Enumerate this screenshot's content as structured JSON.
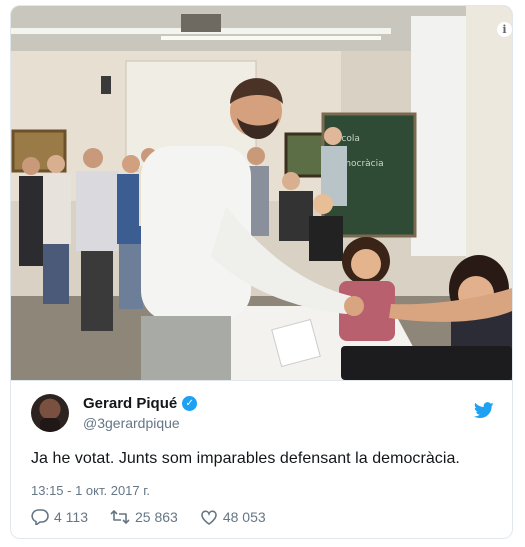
{
  "tweet": {
    "author_name": "Gerard Piqué",
    "handle": "@3gerardpique",
    "text": "Ja he votat. Junts som imparables defensant la democràcia.",
    "timestamp": "13:15 - 1 окт. 2017 г.",
    "replies": "4 113",
    "retweets": "25 863",
    "likes": "48 053"
  },
  "icons": {
    "info": "info-icon",
    "verified": "verified-badge-icon",
    "bird": "twitter-bird-icon",
    "reply": "reply-icon",
    "retweet": "retweet-icon",
    "like": "heart-icon"
  },
  "colors": {
    "accent": "#1da1f2",
    "text": "#14171a",
    "muted": "#657786"
  }
}
